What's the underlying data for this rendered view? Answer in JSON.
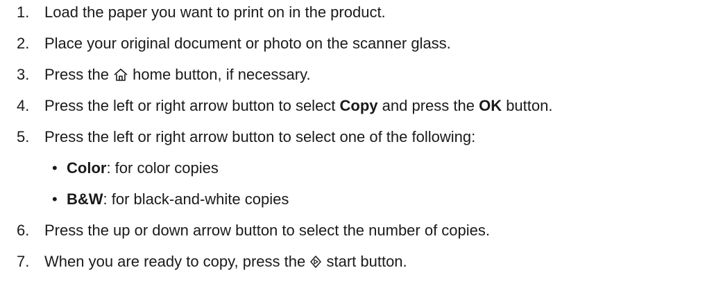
{
  "steps": [
    {
      "num": "1.",
      "text": "Load the paper you want to print on in the product."
    },
    {
      "num": "2.",
      "text": "Place your original document or photo on the scanner glass."
    },
    {
      "num": "3.",
      "pre": "Press the ",
      "icon": "home-icon",
      "post": " home button, if necessary."
    },
    {
      "num": "4.",
      "pre": "Press the left or right arrow button to select ",
      "bold1": "Copy",
      "mid": " and press the ",
      "bold2": "OK",
      "post": " button."
    },
    {
      "num": "5.",
      "text": "Press the left or right arrow button to select one of the following:"
    },
    {
      "num": "6.",
      "text": "Press the up or down arrow button to select the number of copies."
    },
    {
      "num": "7.",
      "pre": "When you are ready to copy, press the ",
      "icon": "start-icon",
      "post": " start button."
    }
  ],
  "options": [
    {
      "bullet": "•",
      "label": "Color",
      "desc": ": for color copies"
    },
    {
      "bullet": "•",
      "label": "B&W",
      "desc": ": for black-and-white copies"
    }
  ]
}
